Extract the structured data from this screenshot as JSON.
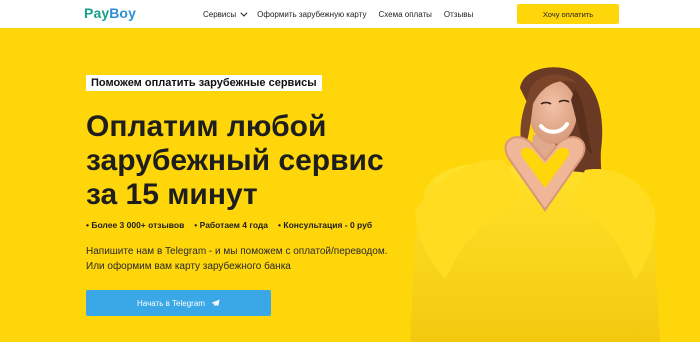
{
  "header": {
    "logo_pay": "Pay",
    "logo_boy": "Boy",
    "nav": [
      {
        "label": "Сервисы",
        "dropdown": true
      },
      {
        "label": "Оформить зарубежную карту"
      },
      {
        "label": "Схема оплаты"
      },
      {
        "label": "Отзывы"
      }
    ],
    "cta_label": "Хочу оплатить"
  },
  "hero": {
    "badge": "Поможем оплатить зарубежные сервисы",
    "headline_lines": [
      "Оплатим любой",
      "зарубежный сервис",
      "за 15 минут"
    ],
    "facts": [
      "Более 3 000+ отзывов",
      "Работаем 4 года",
      "Консультация - 0 руб"
    ],
    "description_lines": [
      "Напишите нам в Telegram - и мы поможем с оплатой/переводом.",
      "Или оформим вам карту зарубежного банка"
    ],
    "button_label": "Начать в Telegram"
  },
  "colors": {
    "background": "#ffd60a",
    "logo_green": "#1a9e8c",
    "logo_blue": "#2f8fd6",
    "button_blue": "#3aa7e6",
    "sweater": "#f6d21a"
  },
  "icons": {
    "nav_dropdown": "chevron-down-icon",
    "telegram": "telegram-icon"
  }
}
